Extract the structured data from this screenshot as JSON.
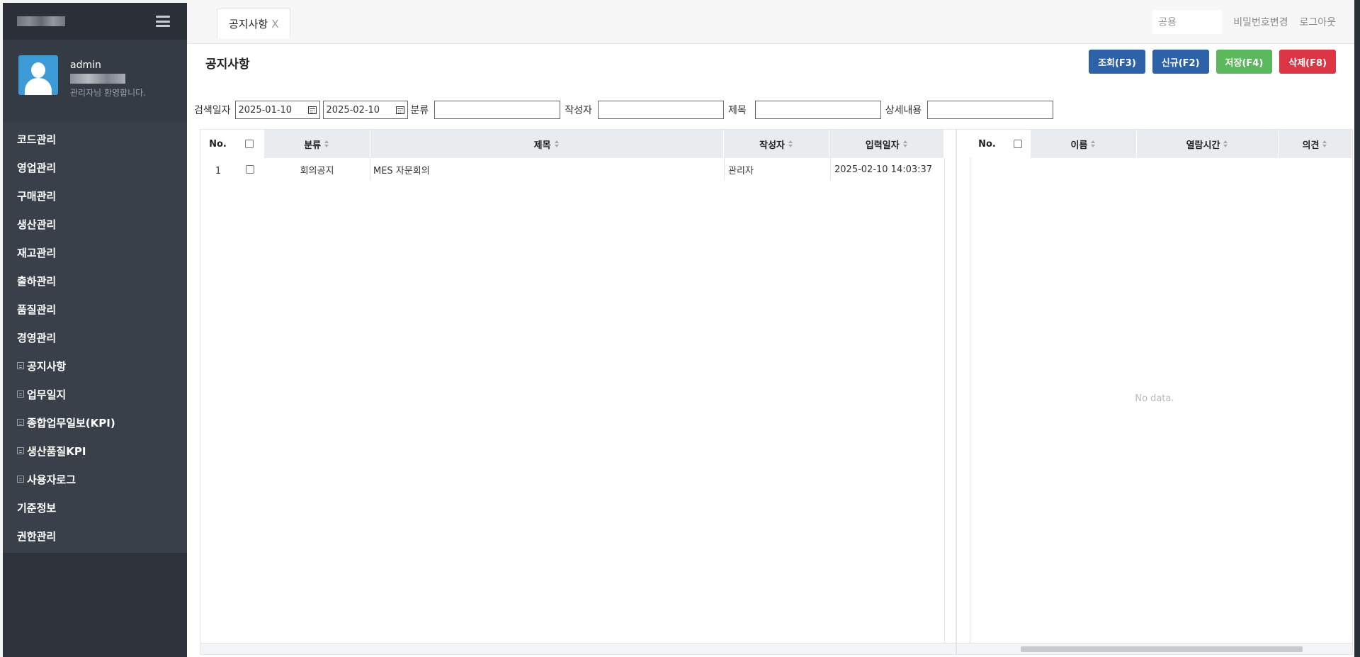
{
  "sidebar": {
    "user_name": "admin",
    "welcome": "관리자님 환영합니다.",
    "items": [
      {
        "label": "코드관리",
        "sub": false
      },
      {
        "label": "영업관리",
        "sub": false
      },
      {
        "label": "구매관리",
        "sub": false
      },
      {
        "label": "생산관리",
        "sub": false
      },
      {
        "label": "재고관리",
        "sub": false
      },
      {
        "label": "출하관리",
        "sub": false
      },
      {
        "label": "품질관리",
        "sub": false
      },
      {
        "label": "경영관리",
        "sub": false
      },
      {
        "label": "공지사항",
        "sub": true
      },
      {
        "label": "업무일지",
        "sub": true
      },
      {
        "label": "종합업무일보(KPI)",
        "sub": true
      },
      {
        "label": "생산품질KPI",
        "sub": true
      },
      {
        "label": "사용자로그",
        "sub": true
      },
      {
        "label": "기준정보",
        "sub": false
      },
      {
        "label": "권한관리",
        "sub": false
      }
    ]
  },
  "topbar": {
    "tab_label": "공지사항",
    "tab_close": "X",
    "public_placeholder": "공용",
    "change_password": "비밀번호변경",
    "logout": "로그아웃"
  },
  "page": {
    "title": "공지사항",
    "buttons": {
      "search": "조회(F3)",
      "new": "신규(F2)",
      "save": "저장(F4)",
      "delete": "삭제(F8)"
    }
  },
  "search": {
    "date_label": "검색일자",
    "date_from": "2025-01-10",
    "date_to": "2025-02-10",
    "category_label": "분류",
    "author_label": "작성자",
    "subject_label": "제목",
    "detail_label": "상세내용"
  },
  "left_grid": {
    "headers": {
      "no": "No.",
      "category": "분류",
      "subject": "제목",
      "author": "작성자",
      "date": "입력일자"
    },
    "rows": [
      {
        "no": "1",
        "category": "회의공지",
        "subject": "MES 자문회의",
        "author": "관리자",
        "date": "2025-02-10 14:03:37"
      }
    ]
  },
  "right_grid": {
    "headers": {
      "no": "No.",
      "name": "이름",
      "read_time": "열람시간",
      "opinion": "의견"
    },
    "empty": "No data."
  }
}
